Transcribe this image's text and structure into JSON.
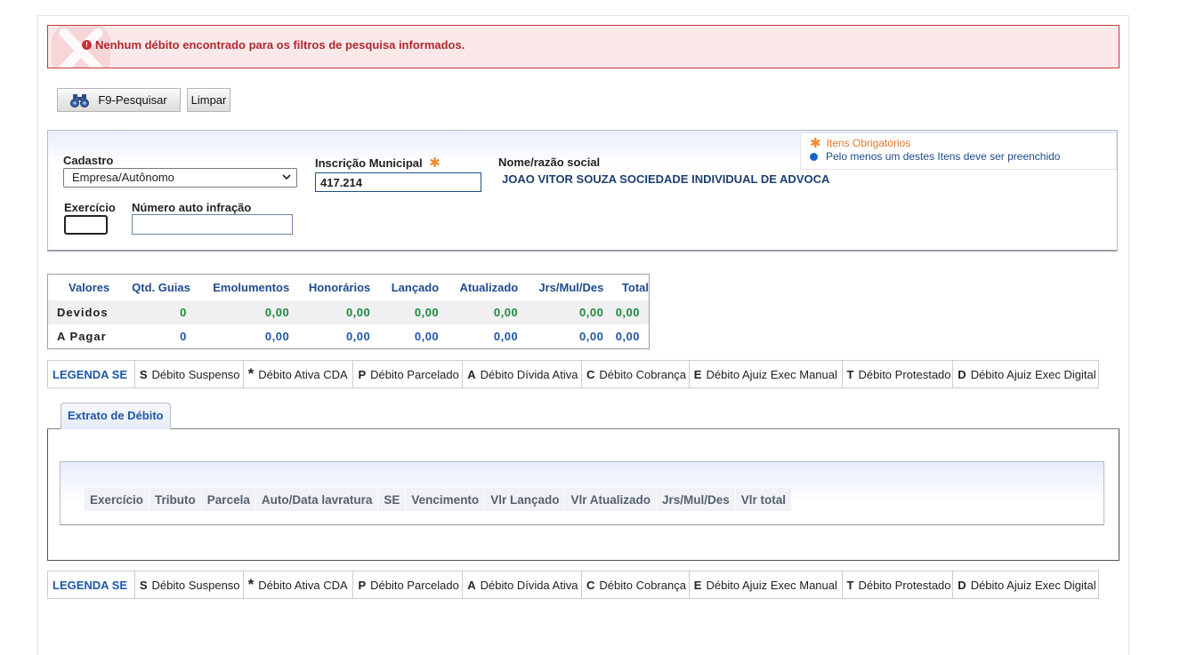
{
  "error": {
    "message": "Nenhum débito encontrado para os filtros de pesquisa informados."
  },
  "toolbar": {
    "search_label": "F9-Pesquisar",
    "clear_label": "Limpar"
  },
  "legend_required": {
    "required_label": "Itens Obrigatórios",
    "one_of_label": "Pelo menos um destes Itens deve ser preenchido"
  },
  "filters": {
    "cadastro_label": "Cadastro",
    "cadastro_value": "Empresa/Autônomo",
    "inscricao_label": "Inscrição Municipal",
    "inscricao_value": "417.214",
    "nome_label": "Nome/razão social",
    "nome_value": "JOAO VITOR SOUZA SOCIEDADE INDIVIDUAL DE ADVOCA",
    "exercicio_label": "Exercício",
    "exercicio_value": "",
    "auto_label": "Número auto infração",
    "auto_value": ""
  },
  "totals": {
    "headers": [
      "Valores",
      "Qtd. Guias",
      "Emolumentos",
      "Honorários",
      "Lançado",
      "Atualizado",
      "Jrs/Mul/Des",
      "Total"
    ],
    "rows": [
      {
        "label": "Devidos",
        "values": [
          "0",
          "0,00",
          "0,00",
          "0,00",
          "0,00",
          "0,00",
          "0,00"
        ]
      },
      {
        "label": "A Pagar",
        "values": [
          "0",
          "0,00",
          "0,00",
          "0,00",
          "0,00",
          "0,00",
          "0,00"
        ]
      }
    ]
  },
  "legend": {
    "title": "LEGENDA SE",
    "items": [
      {
        "code": "S",
        "text": "Débito Suspenso"
      },
      {
        "code": "*",
        "text": "Débito Ativa CDA"
      },
      {
        "code": "P",
        "text": "Débito Parcelado"
      },
      {
        "code": "A",
        "text": "Débito Dívida Ativa"
      },
      {
        "code": "C",
        "text": "Débito Cobrança"
      },
      {
        "code": "E",
        "text": "Débito Ajuiz Exec Manual"
      },
      {
        "code": "T",
        "text": "Débito Protestado"
      },
      {
        "code": "D",
        "text": "Débito Ajuiz Exec Digital"
      }
    ]
  },
  "extrato": {
    "tab_label": "Extrato de Débito",
    "columns": [
      "Exercício",
      "Tributo",
      "Parcela",
      "Auto/Data lavratura",
      "SE",
      "Vencimento",
      "Vlr Lançado",
      "Vlr Atualizado",
      "Jrs/Mul/Des",
      "Vlr total"
    ]
  },
  "colors": {
    "error_text": "#b0282e",
    "error_bg": "#fbe9ea",
    "link_blue": "#1f56a8",
    "green_value": "#1d8a3a",
    "required_orange": "#e8782a"
  }
}
